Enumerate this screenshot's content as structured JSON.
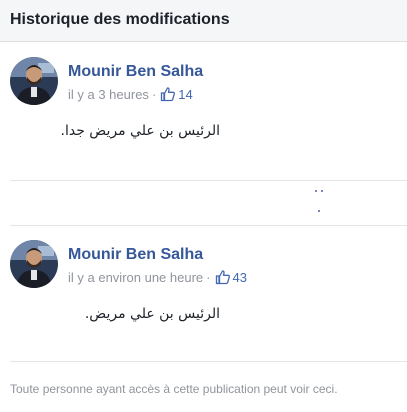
{
  "header": {
    "title": "Historique des modifications"
  },
  "entries": [
    {
      "author": "Mounir Ben Salha",
      "time": "il y a 3 heures",
      "separator": "·",
      "likes": "14",
      "text": "الرئيس بن علي مريض جدا."
    },
    {
      "author": "Mounir Ben Salha",
      "time": "il y a environ une heure",
      "separator": "·",
      "likes": "43",
      "text": "الرئيس بن علي مريض."
    }
  ],
  "footer": {
    "text": "Toute personne ayant accès à cette publication peut voir ceci."
  },
  "colors": {
    "link": "#365899",
    "like": "#4267b2",
    "meta": "#90949c",
    "header_bg": "#f5f6f7"
  }
}
